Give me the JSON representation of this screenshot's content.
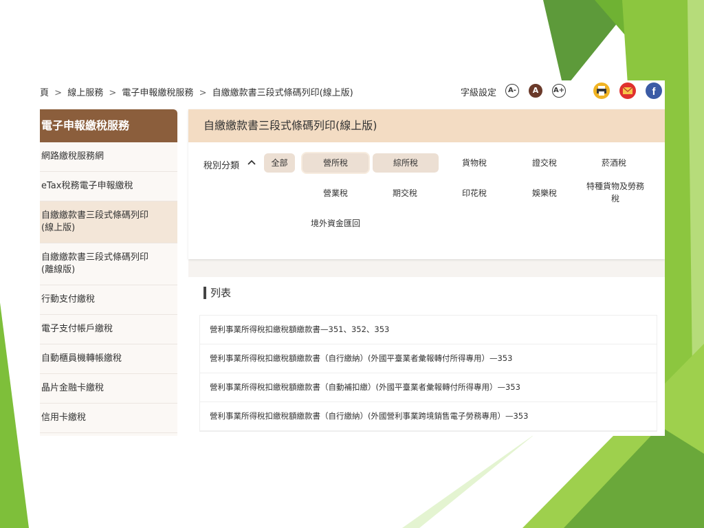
{
  "colors": {
    "accent_brown": "#8b5e3c",
    "header_tan": "#f3dcc3",
    "chip_bg": "#ecdfd3",
    "active_bg": "#f3e6d8",
    "deco_green": "#8cc63f"
  },
  "breadcrumb": [
    "頁",
    "線上服務",
    "電子申報繳稅服務",
    "自繳繳款書三段式條碼列印(線上版)"
  ],
  "breadcrumb_sep": ">",
  "font_settings": {
    "label": "字級設定",
    "smaller": "A-",
    "normal": "A",
    "larger": "A+"
  },
  "share_icons": [
    "printer-icon",
    "mail-icon",
    "facebook-icon"
  ],
  "sidebar": {
    "title": "電子申報繳稅服務",
    "items": [
      {
        "label": "網路繳稅服務網"
      },
      {
        "label": "eTax稅務電子申報繳稅"
      },
      {
        "label": "自繳繳款書三段式條碼列印\n(線上版)"
      },
      {
        "label": "自繳繳款書三段式條碼列印\n(離線版)"
      },
      {
        "label": "行動支付繳稅"
      },
      {
        "label": "電子支付帳戶繳稅"
      },
      {
        "label": "自動櫃員機轉帳繳稅"
      },
      {
        "label": "晶片金融卡繳稅"
      },
      {
        "label": "信用卡繳稅"
      }
    ],
    "active_index": 2
  },
  "filter": {
    "page_title": "自繳繳款書三段式條碼列印(線上版)",
    "label": "稅別分類",
    "collapse_icon": "chevron-up-icon",
    "chips": [
      "全部",
      "營所稅",
      "綜所稅",
      "貨物稅",
      "證交稅",
      "菸酒稅",
      "營業稅",
      "期交稅",
      "印花稅",
      "娛樂稅",
      "特種貨物及勞務\n稅",
      "境外資金匯回"
    ],
    "selected": [
      "營所稅"
    ]
  },
  "list": {
    "title": "列表",
    "rows": [
      "營利事業所得稅扣繳稅額繳款書—351、352、353",
      "營利事業所得稅扣繳稅額繳款書（自行繳納）(外國平臺業者彙報轉付所得專用）—353",
      "營利事業所得稅扣繳稅額繳款書（自動補扣繳）(外國平臺業者彙報轉付所得專用）—353",
      "營利事業所得稅扣繳稅額繳款書（自行繳納）(外國營利事業跨境銷售電子勞務專用）—353"
    ]
  }
}
